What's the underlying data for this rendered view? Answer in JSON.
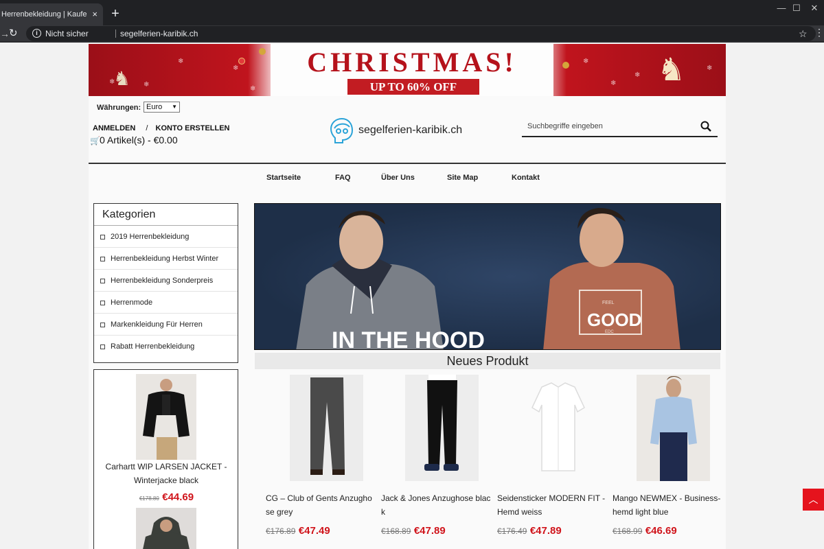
{
  "browser": {
    "tab_title": "Herrenbekleidung | Kaufen Sie Bi",
    "tab_close": "×",
    "new_tab": "+",
    "security_label": "Nicht sicher",
    "url": "segelferien-karibik.ch",
    "window_minimize": "—",
    "window_maximize": "☐",
    "window_close": "✕"
  },
  "banner": {
    "title": "CHRISTMAS!",
    "subtitle": "UP TO 60% OFF"
  },
  "header": {
    "currency_label": "Währungen:",
    "currency_value": "Euro",
    "login": "ANMELDEN",
    "separator": "/",
    "register": "KONTO ERSTELLEN",
    "cart_text": "0 Artikel(s) - €0.00",
    "logo_text": "segelferien-karibik.ch",
    "search_placeholder": "Suchbegriffe eingeben"
  },
  "nav": {
    "items": [
      "Startseite",
      "FAQ",
      "Über Uns",
      "Site Map",
      "Kontakt"
    ]
  },
  "categories": {
    "title": "Kategorien",
    "items": [
      "2019 Herrenbekleidung",
      "Herrenbekleidung Herbst Winter",
      "Herrenbekleidung Sonderpreis",
      "Herrenmode",
      "Markenkleidung Für Herren",
      "Rabatt Herrenbekleidung"
    ]
  },
  "sidebar_product": {
    "name": "Carhartt WIP LARSEN JACKET - Winterjacke black",
    "old_price": "€178.80",
    "new_price": "€44.69"
  },
  "hero": {
    "text_left": "IN THE HOOD",
    "text_right": "GOOD",
    "text_right_top": "FEEL",
    "text_right_bottom": "EDC"
  },
  "main": {
    "section_title": "Neues Produkt",
    "products": [
      {
        "name": "CG – Club of Gents Anzughose grey",
        "old_price": "€176.89",
        "new_price": "€47.49"
      },
      {
        "name": "Jack & Jones Anzughose black",
        "old_price": "€168.89",
        "new_price": "€47.89"
      },
      {
        "name": "Seidensticker MODERN FIT - Hemd weiss",
        "old_price": "€176.49",
        "new_price": "€47.89"
      },
      {
        "name": "Mango NEWMEX - Business­hemd light blue",
        "old_price": "€168.99",
        "new_price": "€46.69"
      }
    ]
  },
  "colors": {
    "accent_red": "#d0141b",
    "banner_red": "#b5121b",
    "logo_blue": "#2aa3d8"
  }
}
